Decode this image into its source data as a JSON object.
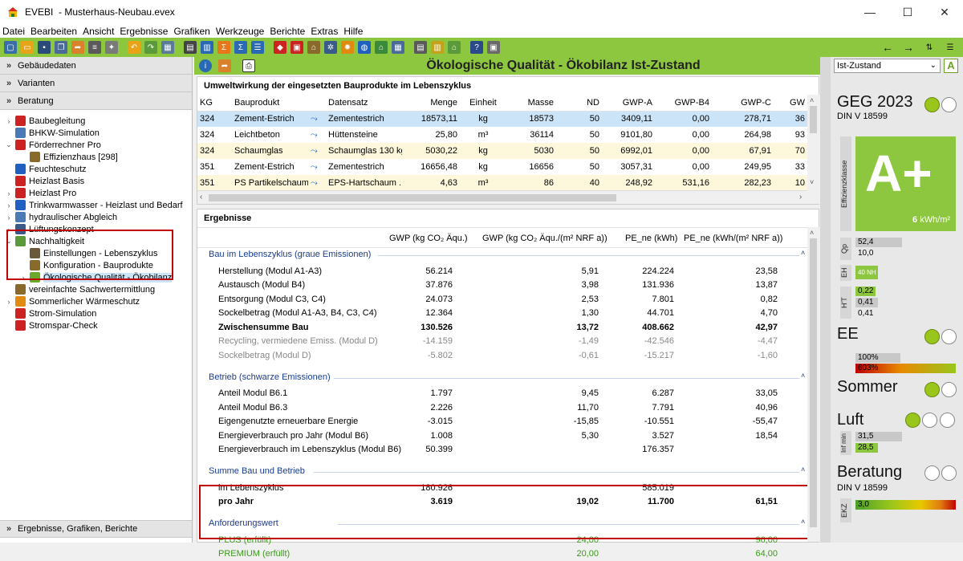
{
  "window": {
    "app_title": "EVEBI",
    "file": "- Musterhaus-Neubau.evex",
    "minimize": "—",
    "maximize": "☐",
    "close": "✕"
  },
  "menu": [
    "Datei",
    "Bearbeiten",
    "Ansicht",
    "Ergebnisse",
    "Grafiken",
    "Werkzeuge",
    "Berichte",
    "Extras",
    "Hilfe"
  ],
  "left": {
    "sections": [
      {
        "label": "Gebäudedaten"
      },
      {
        "label": "Varianten"
      },
      {
        "label": "Beratung"
      }
    ],
    "bottom_section": "Ergebnisse, Grafiken, Berichte",
    "tree": [
      {
        "label": "Baubegleitung",
        "level": 1,
        "icon": "cap-icon",
        "color": "#cc2222",
        "exp": "›"
      },
      {
        "label": "BHKW-Simulation",
        "level": 1,
        "icon": "chp-icon",
        "color": "#4a7ab5",
        "exp": ""
      },
      {
        "label": "Förderrechner Pro",
        "level": 1,
        "icon": "funding-icon",
        "color": "#cc2222",
        "exp": "⌄"
      },
      {
        "label": "Effizienzhaus [298]",
        "level": 2,
        "icon": "house-icon",
        "color": "#8a6a2a",
        "exp": ""
      },
      {
        "label": "Feuchteschutz",
        "level": 1,
        "icon": "drop-icon",
        "color": "#2060c0",
        "exp": ""
      },
      {
        "label": "Heizlast Basis",
        "level": 1,
        "icon": "heatload-icon",
        "color": "#cc2222",
        "exp": ""
      },
      {
        "label": "Heizlast Pro",
        "level": 1,
        "icon": "heatload-icon",
        "color": "#cc2222",
        "exp": "›"
      },
      {
        "label": "Trinkwarmwasser - Heizlast und Bedarf",
        "level": 1,
        "icon": "water-icon",
        "color": "#2060c0",
        "exp": "›"
      },
      {
        "label": "hydraulischer Abgleich",
        "level": 1,
        "icon": "hydraulic-icon",
        "color": "#4a7ab5",
        "exp": "›"
      },
      {
        "label": "Lüftungskonzept",
        "level": 1,
        "icon": "ventilation-icon",
        "color": "#3a5a8a",
        "exp": "›"
      },
      {
        "label": "Nachhaltigkeit",
        "level": 1,
        "icon": "sustainability-icon",
        "color": "#5a9a3a",
        "exp": "⌄"
      },
      {
        "label": "Einstellungen - Lebenszyklus",
        "level": 2,
        "icon": "settings-icon",
        "color": "#6a5a3a",
        "exp": ""
      },
      {
        "label": "Konfiguration - Bauprodukte",
        "level": 2,
        "icon": "config-icon",
        "color": "#8a6a2a",
        "exp": ""
      },
      {
        "label": "Ökologische Qualität - Ökobilanz",
        "level": 2,
        "icon": "tree-icon",
        "color": "#6aaa2a",
        "exp": "›",
        "selected": true
      },
      {
        "label": "vereinfachte Sachwertermittlung",
        "level": 1,
        "icon": "valuation-icon",
        "color": "#8a6a2a",
        "exp": ""
      },
      {
        "label": "Sommerlicher Wärmeschutz",
        "level": 1,
        "icon": "sun-icon",
        "color": "#e08a10",
        "exp": "›"
      },
      {
        "label": "Strom-Simulation",
        "level": 1,
        "icon": "power-sim-icon",
        "color": "#cc2222",
        "exp": ""
      },
      {
        "label": "Stromspar-Check",
        "level": 1,
        "icon": "power-check-icon",
        "color": "#cc2222",
        "exp": ""
      }
    ]
  },
  "main": {
    "title": "Ökologische Qualität - Ökobilanz Ist-Zustand",
    "products_title": "Umweltwirkung der eingesetzten Bauprodukte im Lebenszyklus",
    "products_columns": [
      "KG",
      "Bauprodukt",
      "",
      "Datensatz",
      "Menge",
      "Einheit",
      "Masse",
      "ND",
      "GWP-A",
      "GWP-B4",
      "GWP-C",
      "GW"
    ],
    "products_rows": [
      [
        "324",
        "Zement-Estrich",
        "Zementestrich",
        "18573,11",
        "kg",
        "18573",
        "50",
        "3409,11",
        "0,00",
        "278,71",
        "36"
      ],
      [
        "324",
        "Leichtbeton",
        "Hüttensteine",
        "25,80",
        "m³",
        "36114",
        "50",
        "9101,80",
        "0,00",
        "264,98",
        "93"
      ],
      [
        "324",
        "Schaumglas",
        "Schaumglas 130 kg",
        "5030,22",
        "kg",
        "5030",
        "50",
        "6992,01",
        "0,00",
        "67,91",
        "70"
      ],
      [
        "351",
        "Zement-Estrich",
        "Zementestrich",
        "16656,48",
        "kg",
        "16656",
        "50",
        "3057,31",
        "0,00",
        "249,95",
        "33"
      ],
      [
        "351",
        "PS Partikelschaum",
        "EPS-Hartschaum ...",
        "4,63",
        "m³",
        "86",
        "40",
        "248,92",
        "531,16",
        "282,23",
        "10"
      ]
    ],
    "results_title": "Ergebnisse",
    "results_columns": [
      "GWP (kg CO₂ Äqu.)",
      "GWP (kg CO₂ Äqu./(m² NRF a))",
      "PE_ne (kWh)",
      "PE_ne (kWh/(m² NRF a))"
    ],
    "groups": [
      {
        "title": "Bau im Lebenszyklus (graue Emissionen)",
        "rows": [
          {
            "label": "Herstellung (Modul A1-A3)",
            "v": [
              "56.214",
              "5,91",
              "224.224",
              "23,58"
            ],
            "style": ""
          },
          {
            "label": "Austausch (Modul B4)",
            "v": [
              "37.876",
              "3,98",
              "131.936",
              "13,87"
            ],
            "style": ""
          },
          {
            "label": "Entsorgung (Modul C3, C4)",
            "v": [
              "24.073",
              "2,53",
              "7.801",
              "0,82"
            ],
            "style": ""
          },
          {
            "label": "Sockelbetrag (Modul A1-A3, B4, C3, C4)",
            "v": [
              "12.364",
              "1,30",
              "44.701",
              "4,70"
            ],
            "style": ""
          },
          {
            "label": "Zwischensumme Bau",
            "v": [
              "130.526",
              "13,72",
              "408.662",
              "42,97"
            ],
            "style": "bold"
          },
          {
            "label": "Recycling, vermiedene Emiss. (Modul D)",
            "v": [
              "-14.159",
              "-1,49",
              "-42.546",
              "-4,47"
            ],
            "style": "grey"
          },
          {
            "label": "Sockelbetrag (Modul D)",
            "v": [
              "-5.802",
              "-0,61",
              "-15.217",
              "-1,60"
            ],
            "style": "grey"
          }
        ]
      },
      {
        "title": "Betrieb (schwarze Emissionen)",
        "rows": [
          {
            "label": "Anteil Modul B6.1",
            "v": [
              "1.797",
              "9,45",
              "6.287",
              "33,05"
            ],
            "style": ""
          },
          {
            "label": "Anteil Modul B6.3",
            "v": [
              "2.226",
              "11,70",
              "7.791",
              "40,96"
            ],
            "style": ""
          },
          {
            "label": "Eigengenutzte erneuerbare Energie",
            "v": [
              "-3.015",
              "-15,85",
              "-10.551",
              "-55,47"
            ],
            "style": ""
          },
          {
            "label": "Energieverbrauch pro Jahr (Modul B6)",
            "v": [
              "1.008",
              "5,30",
              "3.527",
              "18,54"
            ],
            "style": ""
          },
          {
            "label": "Energieverbrauch im Lebenszyklus (Modul B6)",
            "v": [
              "50.399",
              "",
              "176.357",
              ""
            ],
            "style": ""
          }
        ]
      },
      {
        "title": "Summe Bau und Betrieb",
        "rows": [
          {
            "label": "im Lebenszyklus",
            "v": [
              "180.926",
              "",
              "585.019",
              ""
            ],
            "style": ""
          },
          {
            "label": "pro Jahr",
            "v": [
              "3.619",
              "19,02",
              "11.700",
              "61,51"
            ],
            "style": "bold"
          }
        ]
      },
      {
        "title": "Anforderungswert",
        "rows": [
          {
            "label": "PLUS (erfüllt)",
            "v": [
              "",
              "24,00",
              "",
              "96,00"
            ],
            "style": "green"
          },
          {
            "label": "PREMIUM (erfüllt)",
            "v": [
              "",
              "20,00",
              "",
              "64,00"
            ],
            "style": "green"
          }
        ]
      }
    ]
  },
  "right": {
    "variant_select": "Ist-Zustand",
    "geg_title": "GEG 2023",
    "geg_norm": "DIN V 18599",
    "eff_label": "Effizienzklasse",
    "eff_class": "A+",
    "eff_value": "6",
    "eff_unit": "kWh/m²",
    "qp_label": "Qp",
    "qp_values": [
      "52,4",
      "10,0"
    ],
    "eh_label": "EH",
    "eh_value": "40 NH",
    "ht_label": "H'T",
    "ht_values": [
      "0,22",
      "0,41",
      "0,41"
    ],
    "ee_title": "EE",
    "ee_values": [
      "100%",
      "603%"
    ],
    "sommer_title": "Sommer",
    "luft_title": "Luft",
    "luft_label": "Inf min",
    "luft_values": [
      "31,5",
      "28,5"
    ],
    "beratung_title": "Beratung",
    "beratung_norm": "DIN V 18599",
    "ekz_label": "EKZ",
    "ekz_value": "3,0",
    "accent": "#8dc63f",
    "alert": "#c00000"
  }
}
